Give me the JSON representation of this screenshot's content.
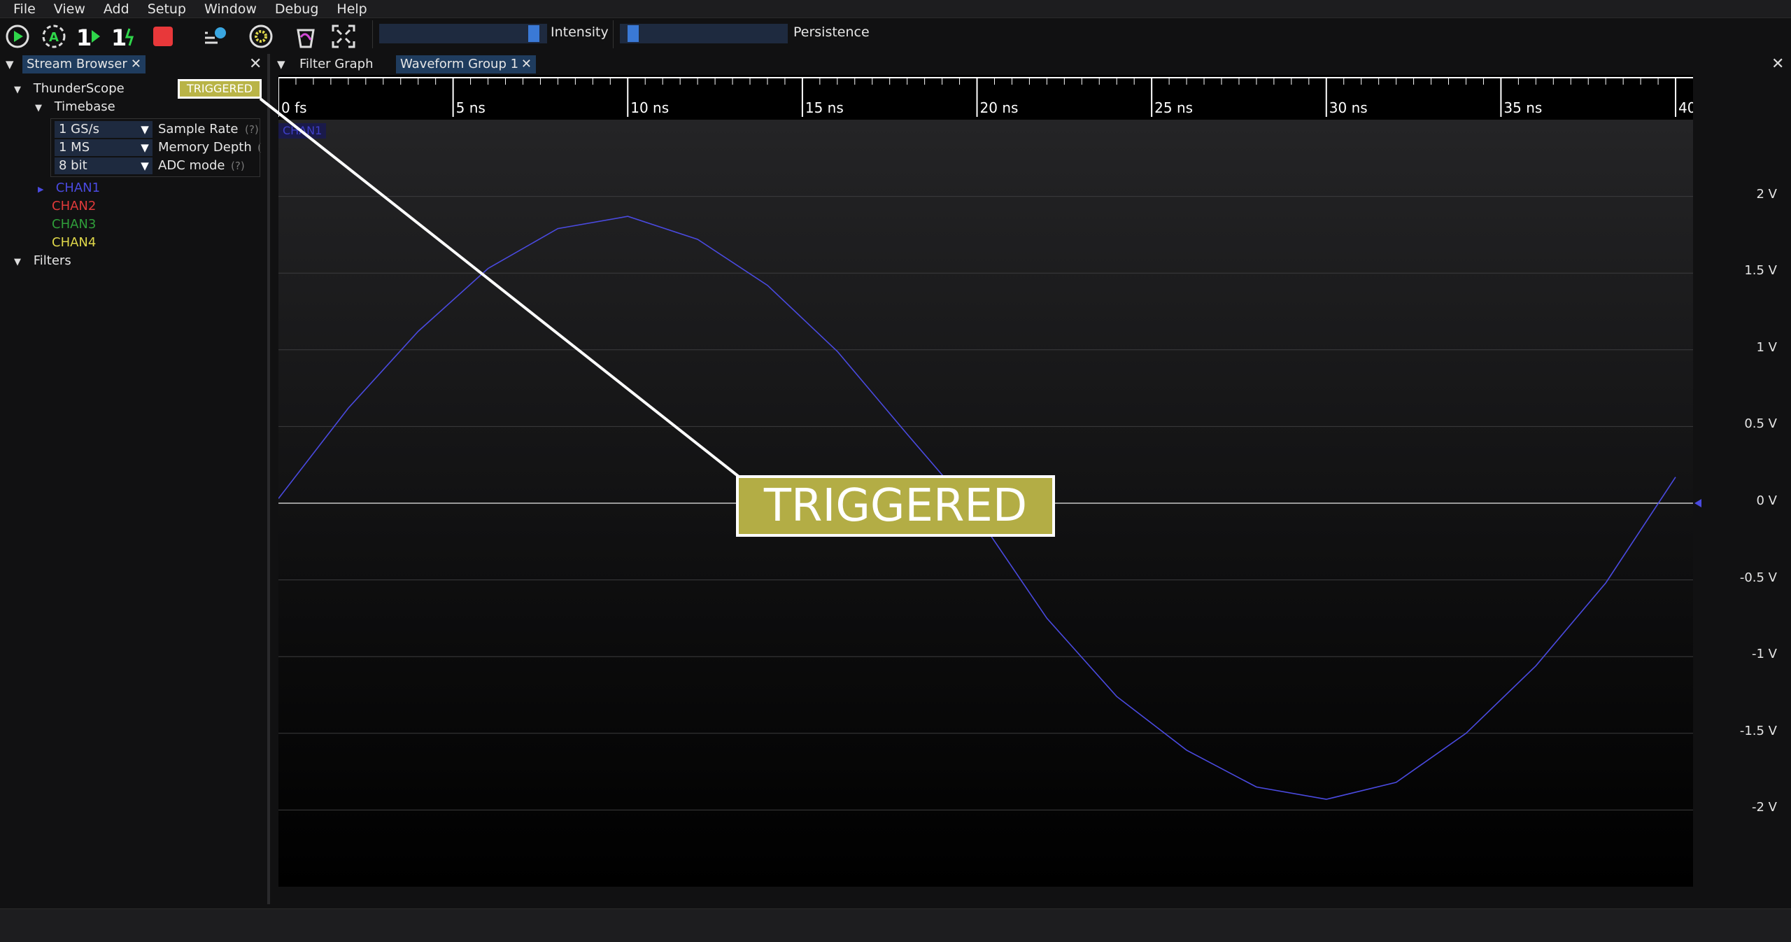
{
  "menu": [
    "File",
    "View",
    "Add",
    "Setup",
    "Window",
    "Debug",
    "Help"
  ],
  "toolbar": {
    "intensity_label": "Intensity",
    "persistence_label": "Persistence",
    "intensity_value": 0.95,
    "persistence_value": 0.05
  },
  "left_panel": {
    "tab_label": "Stream Browser",
    "instrument": "ThunderScope",
    "trigger_badge": "TRIGGERED",
    "timebase_label": "Timebase",
    "props": [
      {
        "value": "1 GS/s",
        "label": "Sample Rate",
        "help": "(?)"
      },
      {
        "value": "1 MS",
        "label": "Memory Depth",
        "help": "("
      },
      {
        "value": "8 bit",
        "label": "ADC mode",
        "help": "(?)"
      }
    ],
    "channels": [
      {
        "name": "CHAN1",
        "color": "#4a4ae0"
      },
      {
        "name": "CHAN2",
        "color": "#e03a3a"
      },
      {
        "name": "CHAN3",
        "color": "#2f9e3a"
      },
      {
        "name": "CHAN4",
        "color": "#e0d84a"
      }
    ],
    "filters_label": "Filters"
  },
  "right_panel": {
    "tabs": [
      "Filter Graph",
      "Waveform Group 1"
    ],
    "channel_tag": "CHAN1",
    "time_ticks": [
      "0 fs",
      "5 ns",
      "10 ns",
      "15 ns",
      "20 ns",
      "25 ns",
      "30 ns",
      "35 ns",
      "40"
    ],
    "y_ticks": [
      "2 V",
      "1.5 V",
      "1 V",
      "0.5 V",
      "0 V",
      "-0.5 V",
      "-1 V",
      "-1.5 V",
      "-2 V"
    ]
  },
  "overlay": {
    "trigger_text": "TRIGGERED"
  },
  "chart_data": {
    "type": "line",
    "series": [
      {
        "name": "CHAN1",
        "color": "#4a4ae0",
        "x_ns": [
          0,
          2,
          4,
          6,
          8,
          10,
          12,
          14,
          16,
          18,
          20,
          22,
          24,
          26,
          28,
          30,
          32,
          34,
          36,
          38,
          40
        ],
        "y_v": [
          0.03,
          0.62,
          1.12,
          1.53,
          1.79,
          1.87,
          1.72,
          1.42,
          0.99,
          0.45,
          -0.08,
          -0.75,
          -1.26,
          -1.61,
          -1.85,
          -1.93,
          -1.82,
          -1.5,
          -1.06,
          -0.52,
          0.17
        ]
      }
    ],
    "xlim": [
      0,
      40.5
    ],
    "ylim": [
      -2.5,
      2.5
    ],
    "grid": true
  }
}
